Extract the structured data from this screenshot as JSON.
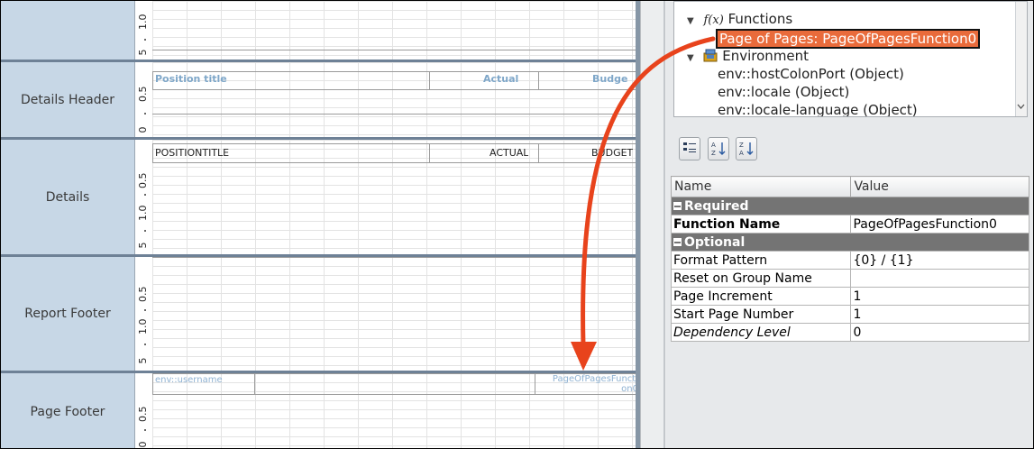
{
  "bands": [
    {
      "label": ""
    },
    {
      "label": "Details Header"
    },
    {
      "label": "Details"
    },
    {
      "label": "Report Footer"
    },
    {
      "label": "Page Footer"
    }
  ],
  "ruler_marks": {
    "r1": "1.0",
    "r5": "5",
    "r05": "0.5",
    "r0": "0"
  },
  "details_header": {
    "position_title": "Position title",
    "actual": "Actual",
    "budget": "Budge"
  },
  "details": {
    "position_title": "POSITIONTITLE",
    "actual": "ACTUAL",
    "budget": "BUDGET"
  },
  "page_footer": {
    "username": "env::username",
    "page_fn_1": "PageOfPagesFuncti",
    "page_fn_2": "on0"
  },
  "tree": {
    "functions": "Functions",
    "functions_icon_text": "f(x)",
    "page_of_pages": "Page of Pages: PageOfPagesFunction0",
    "environment": "Environment",
    "env_host": "env::hostColonPort (Object)",
    "env_locale": "env::locale (Object)",
    "env_locale_lang": "env::locale-language (Object)"
  },
  "toolbar": {
    "categorized": "categorized-icon",
    "sort_az": "A\nZ",
    "sort_za": "Z\nA"
  },
  "props": {
    "col_name": "Name",
    "col_value": "Value",
    "group_required": "Required",
    "group_optional": "Optional",
    "rows_required": [
      {
        "name": "Function Name",
        "value": "PageOfPagesFunction0"
      }
    ],
    "rows_optional": [
      {
        "name": "Format Pattern",
        "value": "{0} / {1}"
      },
      {
        "name": "Reset on Group Name",
        "value": ""
      },
      {
        "name": "Page Increment",
        "value": "1"
      },
      {
        "name": "Start Page Number",
        "value": "1"
      },
      {
        "name": "Dependency Level",
        "value": "0"
      }
    ]
  },
  "colors": {
    "arrow": "#e8431c",
    "selection": "#e96b3b",
    "band_label_bg": "#c7d7e6"
  }
}
